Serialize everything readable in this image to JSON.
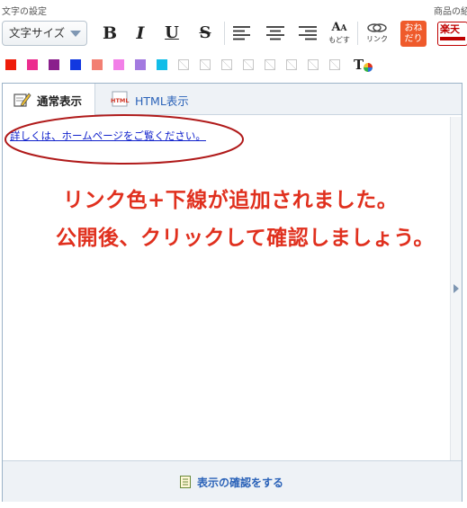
{
  "toolbar": {
    "text_settings_label": "文字の設定",
    "product_label": "商品の紹",
    "font_size_value": "文字サイズ",
    "bold_label": "B",
    "italic_label": "I",
    "underline_label": "U",
    "strike_label": "S",
    "undo_icon_text": "もどす",
    "link_label": "リンク",
    "onedari_label": "おね\nだり",
    "rakuten_label": "楽天"
  },
  "colors": {
    "swatches": [
      "#ee1c0a",
      "#ec2d8f",
      "#8a1f8c",
      "#1238e0",
      "#f27f73",
      "#f27fe8",
      "#a37ae0",
      "#12bde8"
    ],
    "accent_orange": "#ef5a2b",
    "link_blue": "#1122cc",
    "annotation_red": "#e0301e"
  },
  "tabs": [
    {
      "label": "通常表示",
      "icon": "edit-icon",
      "active": true
    },
    {
      "label": "HTML表示",
      "icon": "html-icon",
      "active": false
    }
  ],
  "editor": {
    "link_text": "詳しくは、ホームページをご覧ください。"
  },
  "annotation": {
    "line1": "リンク色+下線が追加されました。",
    "line2": "公開後、クリックして確認しましょう。"
  },
  "footer": {
    "confirm_label": "表示の確認をする"
  }
}
